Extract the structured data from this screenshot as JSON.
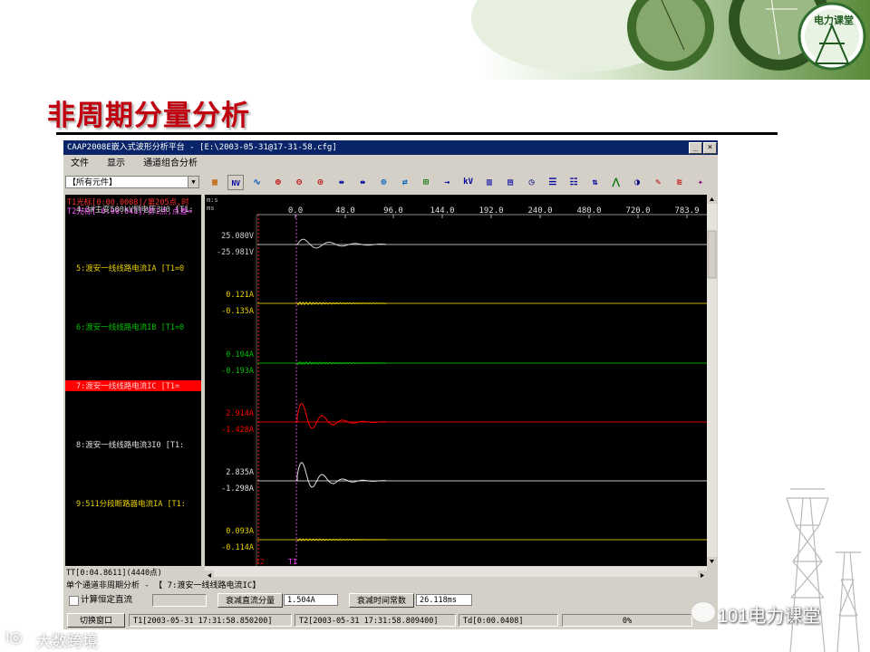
{
  "slide": {
    "title": "非周期分量分析",
    "logo_text": "电力课堂",
    "watermark_wechat": "101电力课堂",
    "watermark_brand": "大数跨境"
  },
  "window": {
    "title": "CAAP2008E嵌入式波形分析平台 - [E:\\2003-05-31@17-31-58.cfg]",
    "menu": [
      "文件",
      "显示",
      "通道组合分析"
    ],
    "combo_value": "【所有元件】",
    "toolbar_icons": [
      "grid-icon",
      "kv-icon",
      "wave-icon",
      "zoom-in-icon",
      "zoom-out-icon",
      "zoom-fit-icon",
      "expand-h-icon",
      "compress-h-icon",
      "zoom-y-icon",
      "swap-icon",
      "zoom-box-icon",
      "arrow-icon",
      "kv-text-icon",
      "rms-icon",
      "harmonic-icon",
      "clock-icon",
      "list-icon",
      "list2-icon",
      "phasor-icon",
      "spectrum-icon",
      "cycle-icon",
      "pen-icon",
      "vector-icon",
      "pin-icon"
    ],
    "toolbar_texts": {
      "kv": "kV",
      "nv": "NV"
    }
  },
  "cursors": {
    "t1": "T1光标[0:00.0008]/第205点,时",
    "t2": "T2光标[-0:00.041]/第1点,点差="
  },
  "time_axis": {
    "units_top": "m:s",
    "units_bottom": "ms",
    "ticks": [
      "0.0",
      "48.0",
      "96.0",
      "144.0",
      "192.0",
      "240.0",
      "480.0",
      "720.0",
      "783.9"
    ]
  },
  "channels": [
    {
      "label": "4:3#主变500kV侧电压3U0 [T1:",
      "max": "25.080V",
      "min": "-25.981V",
      "color": "#cfcfcf",
      "selected": false
    },
    {
      "label": "5:渡安一线线路电流IA [T1=0",
      "max": "0.121A",
      "min": "-0.135A",
      "color": "#e8d000",
      "selected": false
    },
    {
      "label": "6:渡安一线线路电流IB [T1=0",
      "max": "0.104A",
      "min": "-0.193A",
      "color": "#00c000",
      "selected": false
    },
    {
      "label": "7:渡安一线线路电流IC [T1=",
      "max": "2.914A",
      "min": "-1.428A",
      "color": "#ff0000",
      "selected": true
    },
    {
      "label": "8:渡安一线线路电流3I0 [T1:",
      "max": "2.835A",
      "min": "-1.298A",
      "color": "#e0e0e0",
      "selected": false
    },
    {
      "label": "9:511分段断路器电流IA [T1:",
      "max": "0.093A",
      "min": "-0.114A",
      "color": "#e8d000",
      "selected": false
    }
  ],
  "plot_markers": {
    "t2": "T2",
    "t1": "T1"
  },
  "tt": "TT[0:04.8611](4440点)",
  "analysis": {
    "header": "单个通道非周期分析 - 【   7:渡安一线线路电流IC】",
    "checkbox_label": "计算恒定直流",
    "dc_label": "衰减直流分量",
    "dc_value": "1.504A",
    "tau_label": "衰减时间常数",
    "tau_value": "26.118ms"
  },
  "statusbar": {
    "switch_button": "切换窗口",
    "t1": "T1[2003-05-31  17:31:58.850200]",
    "t2": "T2[2003-05-31  17:31:58.809400]",
    "td": "Td[0:00.0408]",
    "progress": "0%",
    "progress_fraction": 0
  }
}
